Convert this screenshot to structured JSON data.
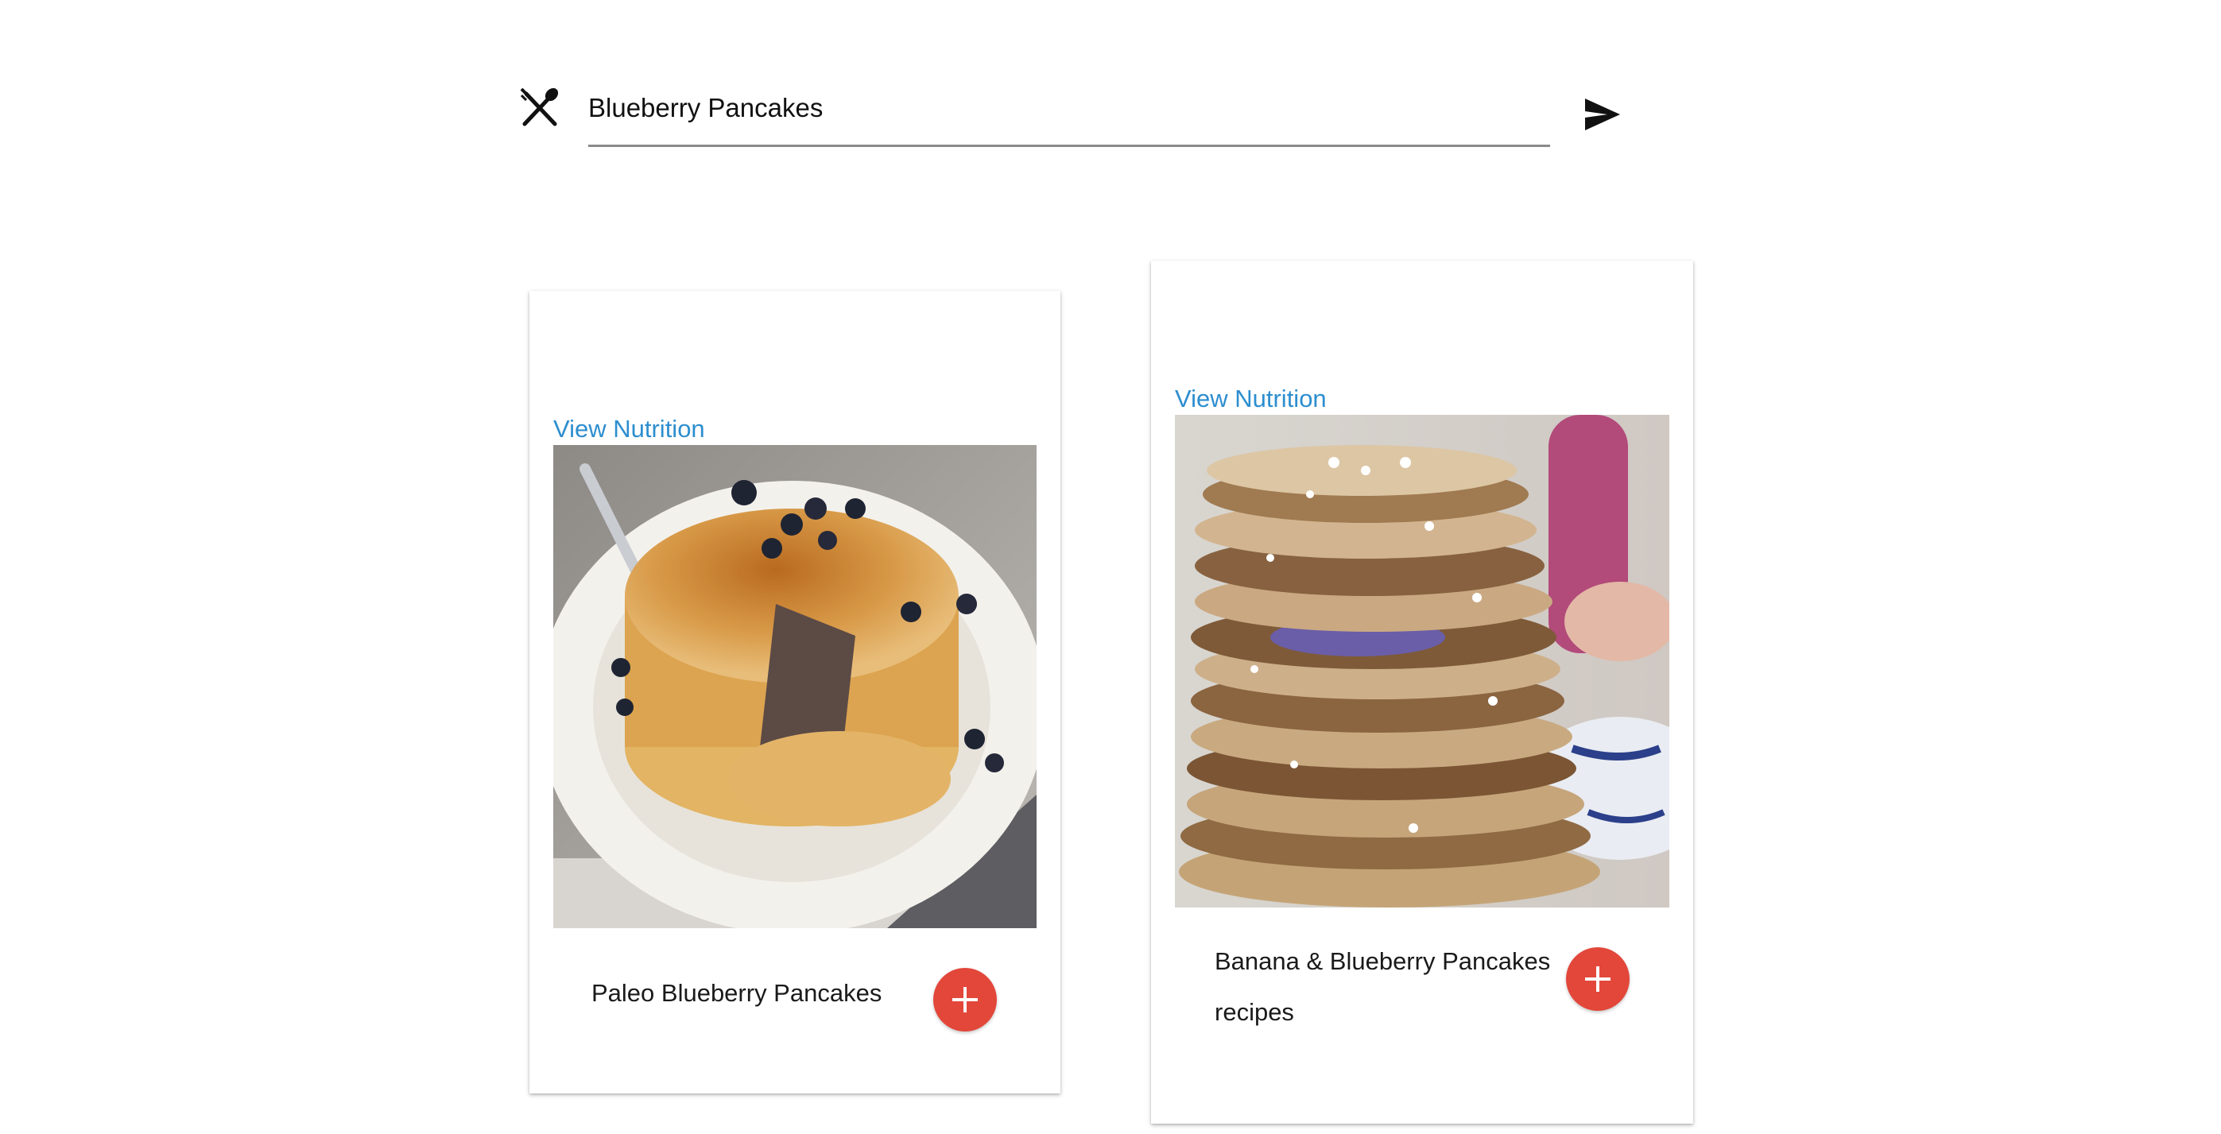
{
  "search": {
    "value": "Blueberry Pancakes",
    "icon": "fork-spoon-icon",
    "send_icon": "send-icon"
  },
  "results": [
    {
      "nutrition_label": "View Nutrition",
      "title": "Paleo Blueberry Pancakes",
      "image_subject": "stack of blueberry pancakes on a white plate with a fork",
      "add_icon": "plus-icon"
    },
    {
      "nutrition_label": "View Nutrition",
      "title": "Banana & Blueberry Pancakes recipes",
      "image_subject": "tall stack of banana pancakes topped with coconut",
      "add_icon": "plus-icon"
    }
  ],
  "colors": {
    "link": "#2d8ecf",
    "add_button": "#e2473a",
    "underline": "#8a8a8a"
  }
}
